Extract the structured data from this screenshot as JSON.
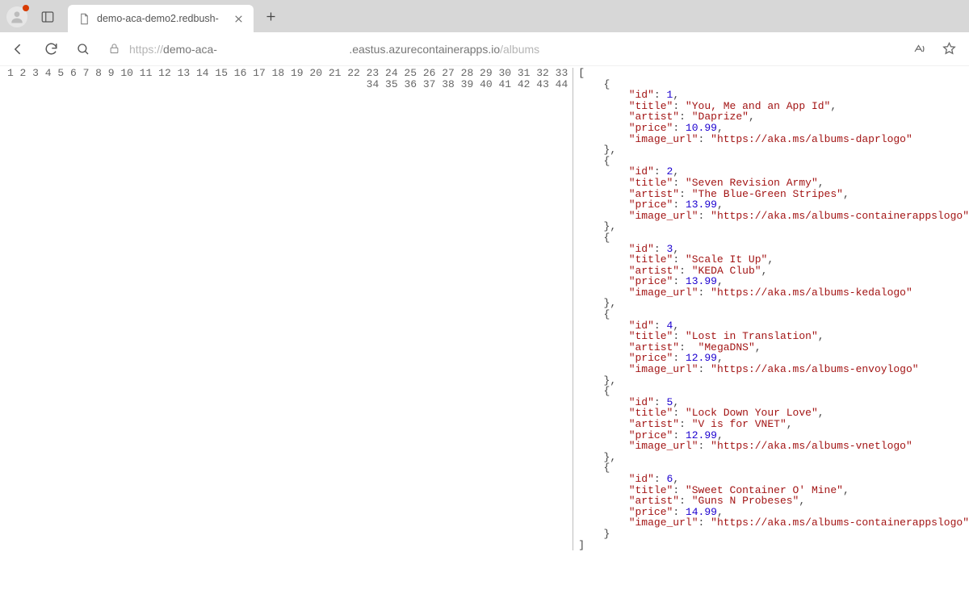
{
  "browser": {
    "tab_title": "demo-aca-demo2.redbush-",
    "url_prefix": "https://",
    "url_host1": "demo-aca-",
    "url_host_gap": "                                          ",
    "url_host2": ".eastus.azurecontainerapps.io",
    "url_path": "/albums"
  },
  "json_response": {
    "albums": [
      {
        "id": 1,
        "title": "You, Me and an App Id",
        "artist": "Daprize",
        "price": 10.99,
        "image_url": "https://aka.ms/albums-daprlogo"
      },
      {
        "id": 2,
        "title": "Seven Revision Army",
        "artist": "The Blue-Green Stripes",
        "price": 13.99,
        "image_url": "https://aka.ms/albums-containerappslogo"
      },
      {
        "id": 3,
        "title": "Scale It Up",
        "artist": "KEDA Club",
        "price": 13.99,
        "image_url": "https://aka.ms/albums-kedalogo"
      },
      {
        "id": 4,
        "title": "Lost in Translation",
        "artist": "MegaDNS",
        "price": 12.99,
        "image_url": "https://aka.ms/albums-envoylogo"
      },
      {
        "id": 5,
        "title": "Lock Down Your Love",
        "artist": "V is for VNET",
        "price": 12.99,
        "image_url": "https://aka.ms/albums-vnetlogo"
      },
      {
        "id": 6,
        "title": "Sweet Container O' Mine",
        "artist": "Guns N Probeses",
        "price": 14.99,
        "image_url": "https://aka.ms/albums-containerappslogo"
      }
    ]
  },
  "line_count": 44
}
